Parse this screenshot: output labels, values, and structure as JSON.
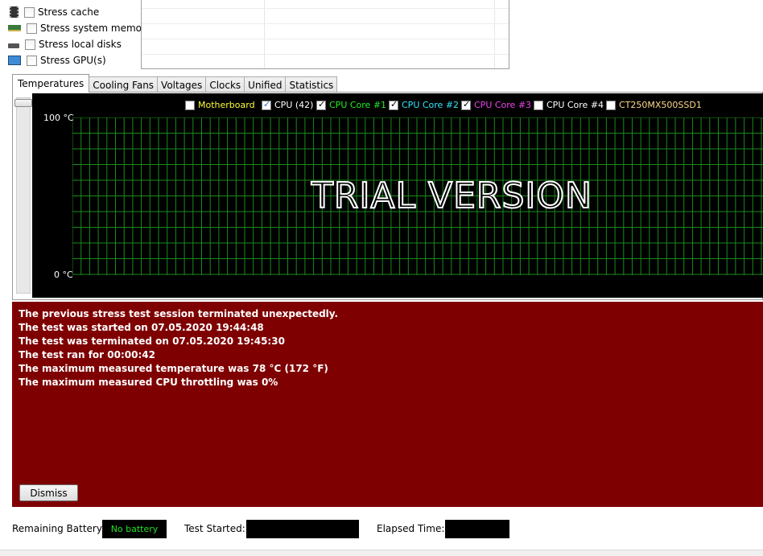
{
  "stress_options": [
    {
      "label": "Stress cache",
      "icon": "cpu-cache-icon",
      "checked": false
    },
    {
      "label": "Stress system memory",
      "icon": "memory-module-icon",
      "checked": false
    },
    {
      "label": "Stress local disks",
      "icon": "disk-drive-icon",
      "checked": false
    },
    {
      "label": "Stress GPU(s)",
      "icon": "monitor-gpu-icon",
      "checked": false
    }
  ],
  "tabs": [
    {
      "label": "Temperatures",
      "active": true
    },
    {
      "label": "Cooling Fans",
      "active": false
    },
    {
      "label": "Voltages",
      "active": false
    },
    {
      "label": "Clocks",
      "active": false
    },
    {
      "label": "Unified",
      "active": false
    },
    {
      "label": "Statistics",
      "active": false
    }
  ],
  "legend": [
    {
      "label": "Motherboard",
      "checked": false,
      "color": "#ffff33"
    },
    {
      "label": "CPU (42)",
      "checked": true,
      "color": "#ffffff"
    },
    {
      "label": "CPU Core #1",
      "checked": true,
      "color": "#22ee22"
    },
    {
      "label": "CPU Core #2",
      "checked": true,
      "color": "#33e6ff"
    },
    {
      "label": "CPU Core #3",
      "checked": true,
      "color": "#ee44ee"
    },
    {
      "label": "CPU Core #4",
      "checked": false,
      "color": "#ffffff"
    },
    {
      "label": "CT250MX500SSD1",
      "checked": false,
      "color": "#ffd98a"
    }
  ],
  "graph": {
    "y_max_label": "100 °C",
    "y_min_label": "0 °C",
    "watermark": "TRIAL VERSION",
    "grid_color": "#1a8a1a"
  },
  "message": {
    "lines": [
      "The previous stress test session terminated unexpectedly.",
      "The test was started on 07.05.2020 19:44:48",
      "The test was terminated on 07.05.2020 19:45:30",
      "The test ran for 00:00:42",
      "The maximum measured temperature was 78 °C  (172 °F)",
      "The maximum measured CPU throttling was 0%"
    ],
    "dismiss_label": "Dismiss",
    "background": "#7f0000"
  },
  "status": {
    "battery_label": "Remaining Battery:",
    "battery_value": "No battery",
    "test_started_label": "Test Started:",
    "test_started_value": "",
    "elapsed_label": "Elapsed Time:",
    "elapsed_value": ""
  }
}
